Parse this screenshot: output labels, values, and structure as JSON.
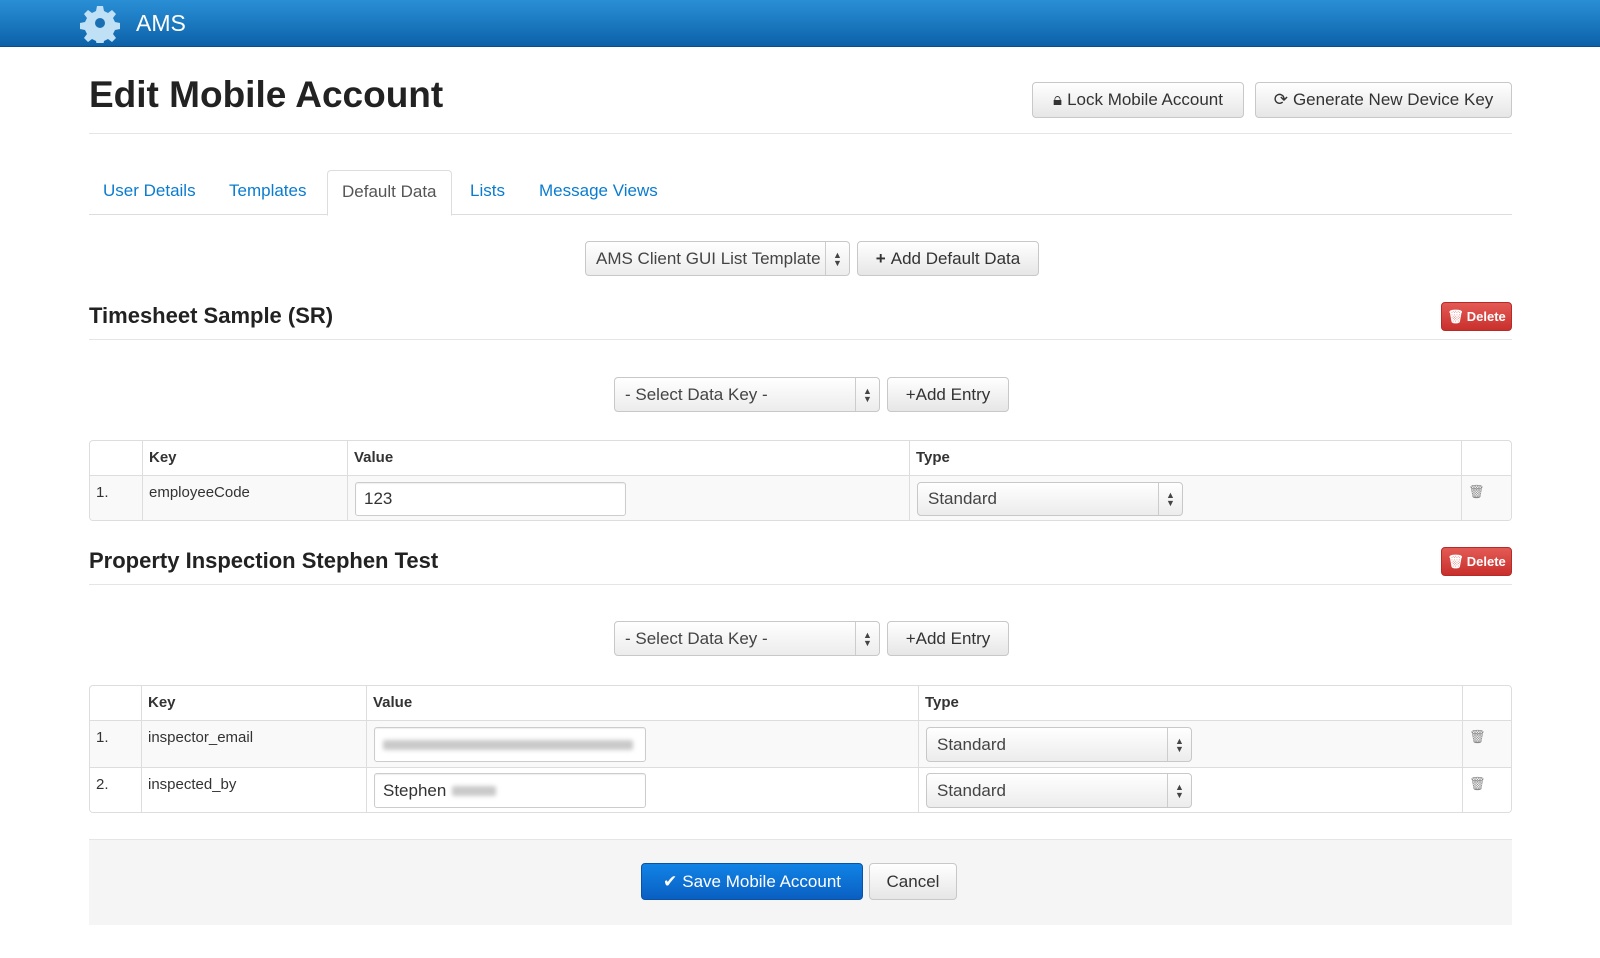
{
  "navbar": {
    "brand": "AMS",
    "logo_icon": "gear-icon"
  },
  "page": {
    "title": "Edit Mobile Account"
  },
  "header_buttons": {
    "lock": "Lock Mobile Account",
    "generate": "Generate New Device Key"
  },
  "tabs": [
    {
      "label": "User Details"
    },
    {
      "label": "Templates"
    },
    {
      "label": "Default Data",
      "active": true
    },
    {
      "label": "Lists"
    },
    {
      "label": "Message Views"
    }
  ],
  "template_select": {
    "value": "AMS Client GUI List Template"
  },
  "add_default_data": "Add Default Data",
  "sections": [
    {
      "title": "Timesheet Sample (SR)",
      "delete": "Delete",
      "key_select": "- Select Data Key -",
      "add_entry": "+Add Entry",
      "columns": [
        "",
        "Key",
        "Value",
        "Type",
        ""
      ],
      "rows": [
        {
          "num": "1.",
          "key": "employeeCode",
          "value": "123",
          "type": "Standard"
        }
      ]
    },
    {
      "title": "Property Inspection Stephen Test",
      "delete": "Delete",
      "key_select": "- Select Data Key -",
      "add_entry": "+Add Entry",
      "columns": [
        "",
        "Key",
        "Value",
        "Type",
        ""
      ],
      "rows": [
        {
          "num": "1.",
          "key": "inspector_email",
          "value": "",
          "type": "Standard"
        },
        {
          "num": "2.",
          "key": "inspected_by",
          "value": "Stephen",
          "type": "Standard"
        }
      ]
    }
  ],
  "footer": {
    "save": "Save Mobile Account",
    "cancel": "Cancel"
  },
  "colors": {
    "navbar": "#1a78c2",
    "primary": "#0e6fd0",
    "danger": "#d9534f",
    "link": "#0a7ccf"
  }
}
